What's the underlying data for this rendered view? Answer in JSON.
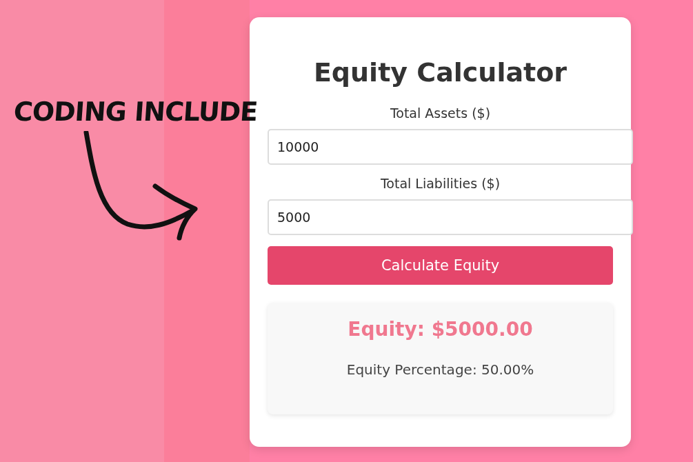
{
  "annotation": {
    "text": "CODING INCLUDE"
  },
  "calculator": {
    "title": "Equity Calculator",
    "fields": [
      {
        "label": "Total Assets ($)",
        "value": "10000"
      },
      {
        "label": "Total Liabilities ($)",
        "value": "5000"
      }
    ],
    "button": "Calculate Equity",
    "result": {
      "equity": "Equity: $5000.00",
      "percentage": "Equity Percentage: 50.00%"
    }
  }
}
